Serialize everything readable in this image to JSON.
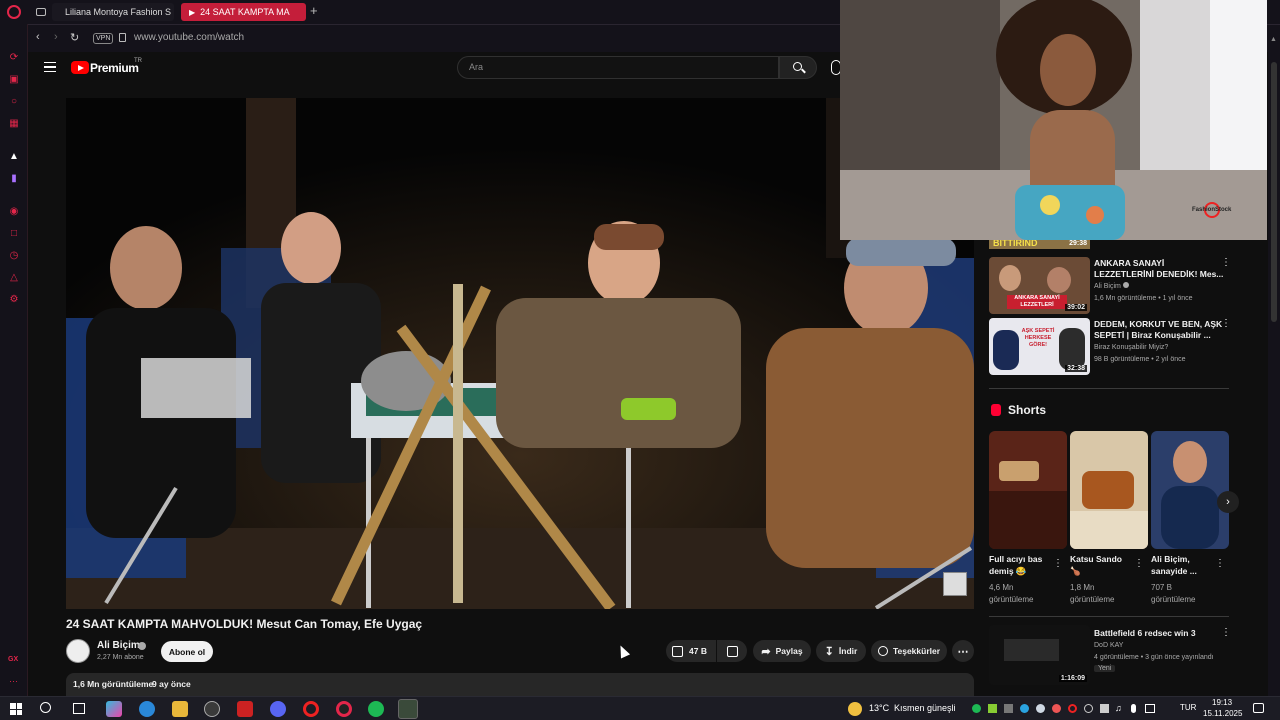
{
  "browser": {
    "tabs": [
      {
        "label": "Liliana Montoya Fashion S"
      },
      {
        "label": "24 SAAT KAMPTA MA"
      }
    ],
    "vpn_badge": "VPN",
    "url": "www.youtube.com/watch",
    "gx_label": "GX"
  },
  "yt_header": {
    "logo_text": "Premium",
    "region": "TR",
    "search_placeholder": "Ara"
  },
  "video": {
    "title": "24 SAAT KAMPTA MAHVOLDUK! Mesut Can Tomay, Efe Uygaç",
    "channel": "Ali Biçim",
    "subscribers": "2,27 Mn abone",
    "subscribe_label": "Abone ol",
    "likes": "47 B",
    "share_label": "Paylaş",
    "download_label": "İndir",
    "thanks_label": "Teşekkürler",
    "views": "1,6 Mn görüntüleme",
    "age": "9 ay önce"
  },
  "mini_player": {
    "watermark": "FashionStock"
  },
  "recommendations": [
    {
      "thumb_text": "29:38",
      "partial_title": "BITTIRIND"
    },
    {
      "title_line1": "ANKARA SANAYİ",
      "title_line2": "LEZZETLERİNİ DENEDİK! Mes...",
      "channel": "Ali Biçim",
      "meta": "1,6 Mn görüntüleme • 1 yıl önce",
      "duration": "39:02",
      "thumb_caption": "ANKARA SANAYİ LEZZETLERİ"
    },
    {
      "title_line1": "DEDEM, KORKUT VE BEN, AŞK",
      "title_line2": "SEPETİ | Biraz Konuşabilir ...",
      "channel": "Biraz Konuşabilir Miyiz?",
      "meta": "98 B görüntüleme • 2 yıl önce",
      "duration": "32:38",
      "thumb_caption": "AŞK SEPETİ HERKESE GÖRE!"
    }
  ],
  "shorts": {
    "heading": "Shorts",
    "items": [
      {
        "title_line1": "Full acıyı bas",
        "title_line2": "demiş 😂",
        "views_line1": "4,6 Mn",
        "views_line2": "görüntüleme"
      },
      {
        "title_line1": "Katsu Sando",
        "title_line2": "🍗",
        "views_line1": "1,8 Mn",
        "views_line2": "görüntüleme"
      },
      {
        "title_line1": "Ali Biçim,",
        "title_line2": "sanayide ...",
        "views_line1": "707 B",
        "views_line2": "görüntüleme"
      }
    ]
  },
  "bottom_rec": {
    "title": "Battlefield 6 redsec win 3",
    "channel": "DoD KAY",
    "meta": "4 görüntüleme • 3 gün önce yayınlandı",
    "badge": "Yeni",
    "duration": "1:16:09"
  },
  "taskbar": {
    "weather": "13°C",
    "weather_text": "Kısmen güneşli",
    "lang": "TUR",
    "time": "19:13",
    "date": "15.11.2025"
  },
  "colors": {
    "opera_red": "#e3264a",
    "yt_red": "#ff0000",
    "bg": "#0f0f0f"
  }
}
